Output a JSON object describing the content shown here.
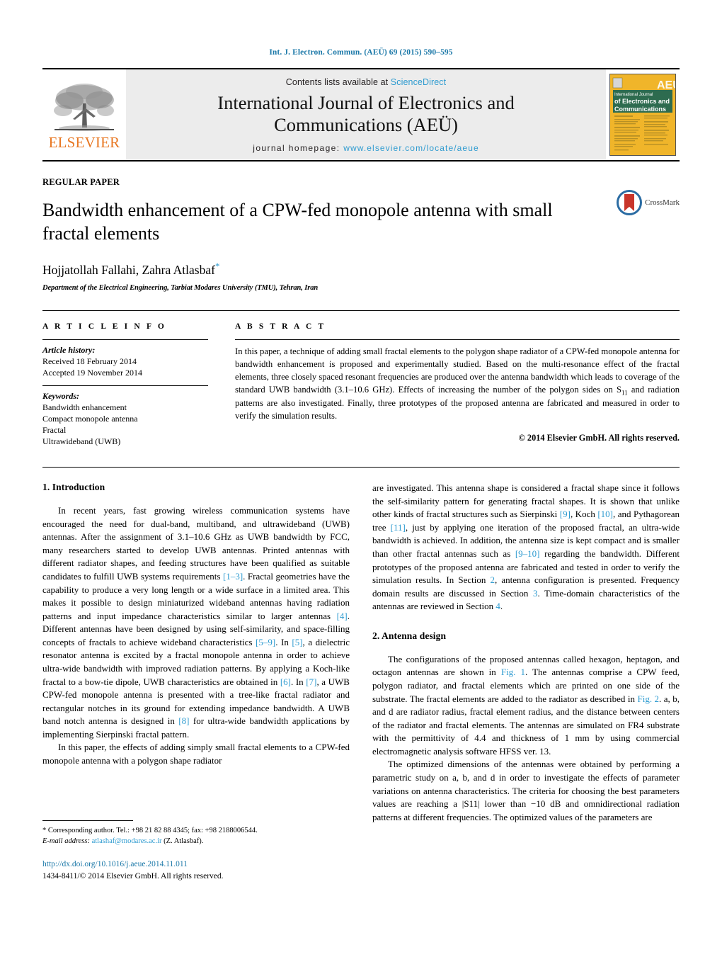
{
  "running_head": "Int. J. Electron. Commun. (AEÜ) 69 (2015) 590–595",
  "masthead": {
    "publisher_name": "ELSEVIER",
    "contents_prefix": "Contents lists available at ",
    "contents_link": "ScienceDirect",
    "journal_title_line1": "International Journal of Electronics and",
    "journal_title_line2": "Communications (AEÜ)",
    "homepage_label": "journal homepage: ",
    "homepage_url": "www.elsevier.com/locate/aeue",
    "cover_aeu": "AEU",
    "cover_line1": "International Journal",
    "cover_line2": "of Electronics and",
    "cover_line3": "Communications"
  },
  "title_block": {
    "article_type": "REGULAR PAPER",
    "title": "Bandwidth enhancement of a CPW-fed monopole antenna with small fractal elements",
    "authors": "Hojjatollah Fallahi, Zahra Atlasbaf",
    "author_star": "*",
    "affiliation": "Department of the Electrical Engineering, Tarbiat Modares University (TMU), Tehran, Iran",
    "crossmark_label": "CrossMark"
  },
  "article_info": {
    "heading": "A R T I C L E   I N F O",
    "history_label": "Article history:",
    "history": [
      "Received 18 February 2014",
      "Accepted 19 November 2014"
    ],
    "keywords_label": "Keywords:",
    "keywords": [
      "Bandwidth enhancement",
      "Compact monopole antenna",
      "Fractal",
      "Ultrawideband (UWB)"
    ]
  },
  "abstract": {
    "heading": "A B S T R A C T",
    "text_part1": "In this paper, a technique of adding small fractal elements to the polygon shape radiator of a CPW-fed monopole antenna for bandwidth enhancement is proposed and experimentally studied. Based on the multi-resonance effect of the fractal elements, three closely spaced resonant frequencies are produced over the antenna bandwidth which leads to coverage of the standard UWB bandwidth (3.1–10.6 GHz). Effects of increasing the number of the polygon sides on S",
    "subscript": "11",
    "text_part2": " and radiation patterns are also investigated. Finally, three prototypes of the proposed antenna are fabricated and measured in order to verify the simulation results.",
    "copyright": "© 2014 Elsevier GmbH. All rights reserved."
  },
  "sections": {
    "intro_heading": "1.  Introduction",
    "intro_p1_a": "In recent years, fast growing wireless communication systems have encouraged the need for dual-band, multiband, and ultrawideband (UWB) antennas. After the assignment of 3.1–10.6 GHz as UWB bandwidth by FCC, many researchers started to develop UWB antennas. Printed antennas with different radiator shapes, and feeding structures have been qualified as suitable candidates to fulfill UWB systems requirements ",
    "ref_1_3": "[1–3]",
    "intro_p1_b": ". Fractal geometries have the capability to produce a very long length or a wide surface in a limited area. This makes it possible to design miniaturized wideband antennas having radiation patterns and input impedance characteristics similar to larger antennas ",
    "ref_4": "[4]",
    "intro_p1_c": ". Different antennas have been designed by using self-similarity, and space-filling concepts of fractals to achieve wideband characteristics ",
    "ref_5_9": "[5–9]",
    "intro_p1_d": ". In ",
    "ref_5": "[5]",
    "intro_p1_e": ", a dielectric resonator antenna is excited by a fractal monopole antenna in order to achieve ultra-wide bandwidth with improved radiation patterns. By applying a Koch-like fractal to a bow-tie dipole, UWB characteristics are obtained in ",
    "ref_6": "[6]",
    "intro_p1_f": ". In ",
    "ref_7": "[7]",
    "intro_p1_g": ", a UWB CPW-fed monopole antenna is presented with a tree-like fractal radiator and rectangular notches in its ground for extending impedance bandwidth. A UWB band notch antenna is designed in ",
    "ref_8": "[8]",
    "intro_p1_h": " for ultra-wide bandwidth applications by implementing Sierpinski fractal pattern.",
    "intro_p2": "In this paper, the effects of adding simply small fractal elements to a CPW-fed monopole antenna with a polygon shape radiator",
    "intro_p2_cont_a": "are investigated. This antenna shape is considered a fractal shape since it follows the self-similarity pattern for generating fractal shapes. It is shown that unlike other kinds of fractal structures such as Sierpinski ",
    "ref_9": "[9]",
    "intro_p2_cont_b": ", Koch ",
    "ref_10": "[10]",
    "intro_p2_cont_c": ", and Pythagorean tree ",
    "ref_11": "[11]",
    "intro_p2_cont_d": ", just by applying one iteration of the proposed fractal, an ultra-wide bandwidth is achieved. In addition, the antenna size is kept compact and is smaller than other fractal antennas such as ",
    "ref_9_10": "[9–10]",
    "intro_p2_cont_e": " regarding the bandwidth. Different prototypes of the proposed antenna are fabricated and tested in order to verify the simulation results. In Section ",
    "ref_sec2": "2",
    "intro_p2_cont_f": ", antenna configuration is presented. Frequency domain results are discussed in Section ",
    "ref_sec3": "3",
    "intro_p2_cont_g": ". Time-domain characteristics of the antennas are reviewed in Section ",
    "ref_sec4": "4",
    "intro_p2_cont_h": ".",
    "antenna_heading": "2.  Antenna design",
    "antenna_p1_a": "The configurations of the proposed antennas called hexagon, heptagon, and octagon antennas are shown in ",
    "ref_fig1": "Fig. 1",
    "antenna_p1_b": ". The antennas comprise a CPW feed, polygon radiator, and fractal elements which are printed on one side of the substrate. The fractal elements are added to the radiator as described in ",
    "ref_fig2": "Fig. 2",
    "antenna_p1_c": ". a, b, and d are radiator radius, fractal element radius, and the distance between centers of the radiator and fractal elements. The antennas are simulated on FR4 substrate with the permittivity of 4.4 and thickness of 1 mm by using commercial electromagnetic analysis software HFSS ver. 13.",
    "antenna_p2": "The optimized dimensions of the antennas were obtained by performing a parametric study on a, b, and d in order to investigate the effects of parameter variations on antenna characteristics. The criteria for choosing the best parameters values are reaching a |S11| lower than −10 dB and omnidirectional radiation patterns at different frequencies. The optimized values of the parameters are"
  },
  "footnote": {
    "corresponding": "* Corresponding author. Tel.: +98 21 82 88 4345; fax: +98 2188006544.",
    "email_label": "E-mail address:",
    "email": "atlashaf@modares.ac.ir",
    "email_suffix": "(Z. Atlasbaf).",
    "doi": "http://dx.doi.org/10.1016/j.aeue.2014.11.011",
    "issn": "1434-8411/© 2014 Elsevier GmbH. All rights reserved."
  }
}
